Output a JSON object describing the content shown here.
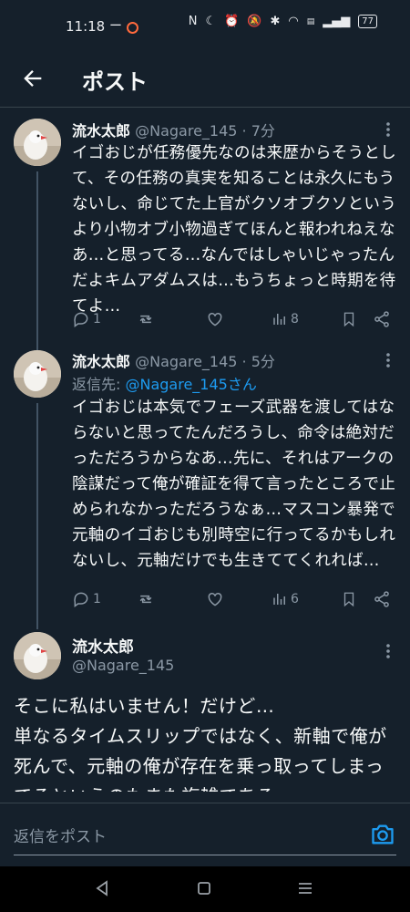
{
  "status_bar": {
    "time": "11:18",
    "dash": "ー",
    "battery": "77"
  },
  "header": {
    "title": "ポスト"
  },
  "tweets": [
    {
      "name": "流水太郎",
      "handle": "@Nagare_145",
      "time": "· 7分",
      "body": "イゴおじが任務優先なのは来歴からそうとして、その任務の真実を知ることは永久にもうないし、命じてた上官がクソオブクソというより小物オブ小物過ぎてほんと報われねえなあ…と思ってる…なんではしゃいじゃったんだよキムアダムスは…もうちょっと時期を待てよ…",
      "replies": "1",
      "views": "8"
    },
    {
      "name": "流水太郎",
      "handle": "@Nagare_145",
      "time": "· 5分",
      "reply_to_prefix": "返信先: ",
      "reply_to_user": "@Nagare_145さん",
      "body": "イゴおじは本気でフェーズ武器を渡してはならないと思ってたんだろうし、命令は絶対だっただろうからなあ…先に、それはアークの陰謀だって俺が確証を得て言ったところで止められなかっただろうなぁ…マスコン暴発で元軸のイゴおじも別時空に行ってるかもしれないし、元軸だけでも生きててくれれば…",
      "replies": "1",
      "views": "6"
    },
    {
      "name": "流水太郎",
      "handle": "@Nagare_145",
      "body": "そこに私はいません！だけど…\n単なるタイムスリップではなく、新軸で俺が死んで、元軸の俺が存在を乗っ取ってしまってるというのもまた複雑である"
    }
  ],
  "reply_bar": {
    "placeholder": "返信をポスト"
  },
  "colors": {
    "background": "#15202b",
    "accent": "#1d9bf0",
    "muted": "#8b98a5"
  }
}
